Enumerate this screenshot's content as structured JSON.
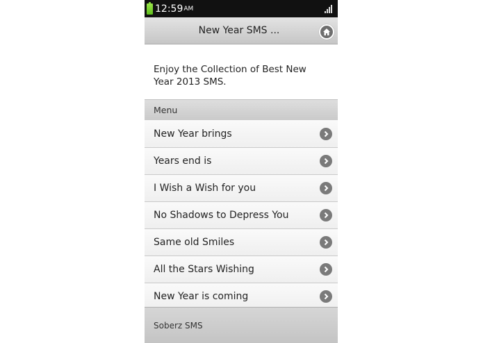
{
  "status_bar": {
    "time": "12:59",
    "ampm": "AM"
  },
  "header": {
    "title": "New Year SMS ...",
    "home_icon": "home-icon"
  },
  "intro": {
    "text": "Enjoy the Collection of Best New Year 2013 SMS."
  },
  "menu": {
    "heading": "Menu",
    "items": [
      {
        "label": "New Year brings"
      },
      {
        "label": "Years end is"
      },
      {
        "label": "I Wish a Wish for you"
      },
      {
        "label": "No Shadows to Depress You"
      },
      {
        "label": "Same old Smiles"
      },
      {
        "label": "All the Stars Wishing"
      },
      {
        "label": "New Year is coming"
      }
    ]
  },
  "footer": {
    "text": "Soberz SMS"
  }
}
